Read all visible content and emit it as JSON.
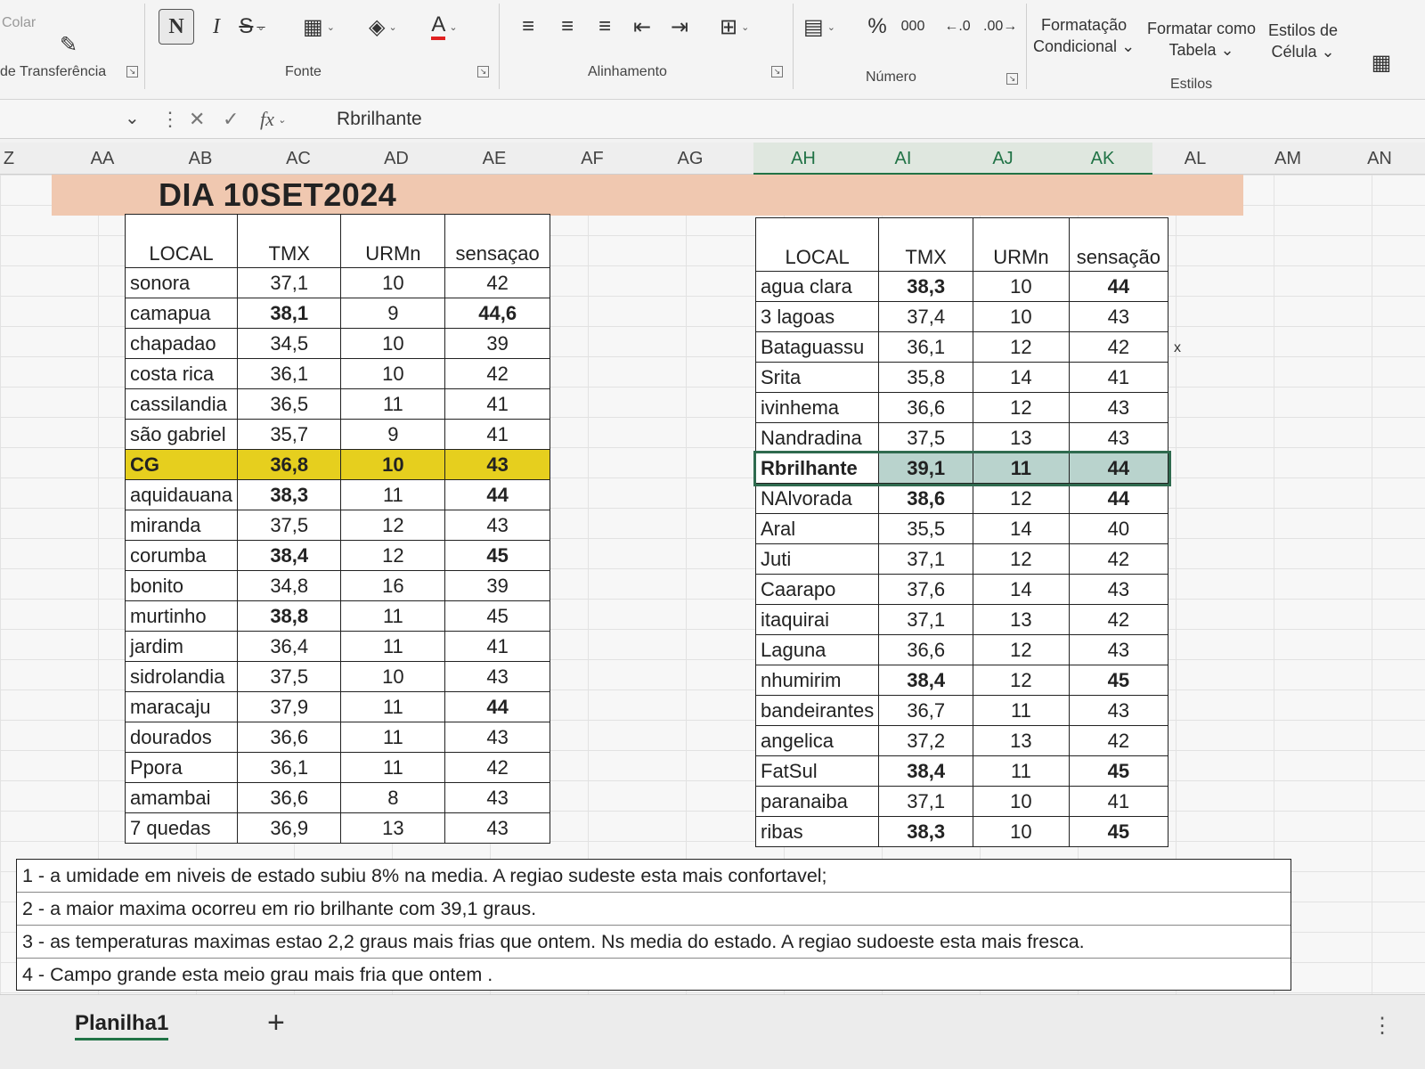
{
  "ribbon": {
    "paste_label": "Colar",
    "groups": [
      "de Transferência",
      "Fonte",
      "Alinhamento",
      "Número",
      "Estilos"
    ],
    "bold_label": "N",
    "italic_label": "I",
    "strike_label": "S",
    "percent_label": "%",
    "thousands_label": "000",
    "styles": {
      "conditional_line1": "Formatação",
      "conditional_line2": "Condicional",
      "table_line1": "Formatar como",
      "table_line2": "Tabela",
      "cell_line1": "Estilos de",
      "cell_line2": "Célula"
    }
  },
  "formula_bar": {
    "value": "Rbrilhante"
  },
  "columns": [
    "Z",
    "AA",
    "AB",
    "AC",
    "AD",
    "AE",
    "AF",
    "AG",
    "AH",
    "AI",
    "AJ",
    "AK",
    "AL",
    "AM",
    "AN"
  ],
  "colors": {
    "banner": "#f0c8b0",
    "highlight_yellow": "#e6cf1e",
    "selected_row": "#b9d3cd",
    "accent_green": "#217346"
  },
  "report": {
    "title": "DIA 10SET2024",
    "stray_mark": "x",
    "left_table": {
      "headers": [
        "LOCAL",
        "TMX",
        "URMn",
        "sensaçao"
      ],
      "rows": [
        {
          "local": "sonora",
          "tmx": "37,1",
          "urmn": "10",
          "sensacao": "42",
          "bold": []
        },
        {
          "local": "camapua",
          "tmx": "38,1",
          "urmn": "9",
          "sensacao": "44,6",
          "bold": [
            "tmx",
            "sensacao"
          ]
        },
        {
          "local": "chapadao",
          "tmx": "34,5",
          "urmn": "10",
          "sensacao": "39",
          "bold": []
        },
        {
          "local": "costa rica",
          "tmx": "36,1",
          "urmn": "10",
          "sensacao": "42",
          "bold": []
        },
        {
          "local": "cassilandia",
          "tmx": "36,5",
          "urmn": "11",
          "sensacao": "41",
          "bold": []
        },
        {
          "local": "são gabriel",
          "tmx": "35,7",
          "urmn": "9",
          "sensacao": "41",
          "bold": []
        },
        {
          "local": "CG",
          "tmx": "36,8",
          "urmn": "10",
          "sensacao": "43",
          "bold": [],
          "highlight": "yellow"
        },
        {
          "local": "aquidauana",
          "tmx": "38,3",
          "urmn": "11",
          "sensacao": "44",
          "bold": [
            "tmx",
            "sensacao"
          ]
        },
        {
          "local": "miranda",
          "tmx": "37,5",
          "urmn": "12",
          "sensacao": "43",
          "bold": []
        },
        {
          "local": "corumba",
          "tmx": "38,4",
          "urmn": "12",
          "sensacao": "45",
          "bold": [
            "tmx",
            "sensacao"
          ]
        },
        {
          "local": "bonito",
          "tmx": "34,8",
          "urmn": "16",
          "sensacao": "39",
          "bold": []
        },
        {
          "local": "murtinho",
          "tmx": "38,8",
          "urmn": "11",
          "sensacao": "45",
          "bold": [
            "tmx"
          ]
        },
        {
          "local": "jardim",
          "tmx": "36,4",
          "urmn": "11",
          "sensacao": "41",
          "bold": []
        },
        {
          "local": "sidrolandia",
          "tmx": "37,5",
          "urmn": "10",
          "sensacao": "43",
          "bold": []
        },
        {
          "local": "maracaju",
          "tmx": "37,9",
          "urmn": "11",
          "sensacao": "44",
          "bold": [
            "sensacao"
          ]
        },
        {
          "local": "dourados",
          "tmx": "36,6",
          "urmn": "11",
          "sensacao": "43",
          "bold": []
        },
        {
          "local": "Ppora",
          "tmx": "36,1",
          "urmn": "11",
          "sensacao": "42",
          "bold": []
        },
        {
          "local": "amambai",
          "tmx": "36,6",
          "urmn": "8",
          "sensacao": "43",
          "bold": []
        },
        {
          "local": "7 quedas",
          "tmx": "36,9",
          "urmn": "13",
          "sensacao": "43",
          "bold": []
        }
      ]
    },
    "right_table": {
      "headers": [
        "LOCAL",
        "TMX",
        "URMn",
        "sensação"
      ],
      "rows": [
        {
          "local": "agua clara",
          "tmx": "38,3",
          "urmn": "10",
          "sensacao": "44",
          "bold": [
            "tmx",
            "sensacao"
          ]
        },
        {
          "local": "3 lagoas",
          "tmx": "37,4",
          "urmn": "10",
          "sensacao": "43",
          "bold": []
        },
        {
          "local": "Bataguassu",
          "tmx": "36,1",
          "urmn": "12",
          "sensacao": "42",
          "bold": []
        },
        {
          "local": "Srita",
          "tmx": "35,8",
          "urmn": "14",
          "sensacao": "41",
          "bold": []
        },
        {
          "local": "ivinhema",
          "tmx": "36,6",
          "urmn": "12",
          "sensacao": "43",
          "bold": []
        },
        {
          "local": "Nandradina",
          "tmx": "37,5",
          "urmn": "13",
          "sensacao": "43",
          "bold": []
        },
        {
          "local": "Rbrilhante",
          "tmx": "39,1",
          "urmn": "11",
          "sensacao": "44",
          "bold": [],
          "highlight": "selected"
        },
        {
          "local": "NAlvorada",
          "tmx": "38,6",
          "urmn": "12",
          "sensacao": "44",
          "bold": [
            "tmx",
            "sensacao"
          ]
        },
        {
          "local": "Aral",
          "tmx": "35,5",
          "urmn": "14",
          "sensacao": "40",
          "bold": []
        },
        {
          "local": "Juti",
          "tmx": "37,1",
          "urmn": "12",
          "sensacao": "42",
          "bold": []
        },
        {
          "local": "Caarapo",
          "tmx": "37,6",
          "urmn": "14",
          "sensacao": "43",
          "bold": []
        },
        {
          "local": "itaquirai",
          "tmx": "37,1",
          "urmn": "13",
          "sensacao": "42",
          "bold": []
        },
        {
          "local": "Laguna",
          "tmx": "36,6",
          "urmn": "12",
          "sensacao": "43",
          "bold": []
        },
        {
          "local": "nhumirim",
          "tmx": "38,4",
          "urmn": "12",
          "sensacao": "45",
          "bold": [
            "tmx",
            "sensacao"
          ]
        },
        {
          "local": "bandeirantes",
          "tmx": "36,7",
          "urmn": "11",
          "sensacao": "43",
          "bold": []
        },
        {
          "local": "angelica",
          "tmx": "37,2",
          "urmn": "13",
          "sensacao": "42",
          "bold": []
        },
        {
          "local": "FatSul",
          "tmx": "38,4",
          "urmn": "11",
          "sensacao": "45",
          "bold": [
            "tmx",
            "sensacao"
          ]
        },
        {
          "local": "paranaiba",
          "tmx": "37,1",
          "urmn": "10",
          "sensacao": "41",
          "bold": []
        },
        {
          "local": "ribas",
          "tmx": "38,3",
          "urmn": "10",
          "sensacao": "45",
          "bold": [
            "tmx",
            "sensacao"
          ]
        }
      ]
    },
    "notes": [
      "1 - a umidade em niveis de estado subiu 8% na media. A regiao sudeste esta mais confortavel;",
      "2 - a maior maxima ocorreu em rio  brilhante com 39,1 graus.",
      "3 - as temperaturas maximas estao 2,2 graus mais frias que ontem. Ns media do estado.  A regiao sudoeste esta mais fresca.",
      "4 - Campo grande esta meio grau mais fria que ontem ."
    ]
  },
  "sheet_tabs": [
    "Planilha1"
  ]
}
